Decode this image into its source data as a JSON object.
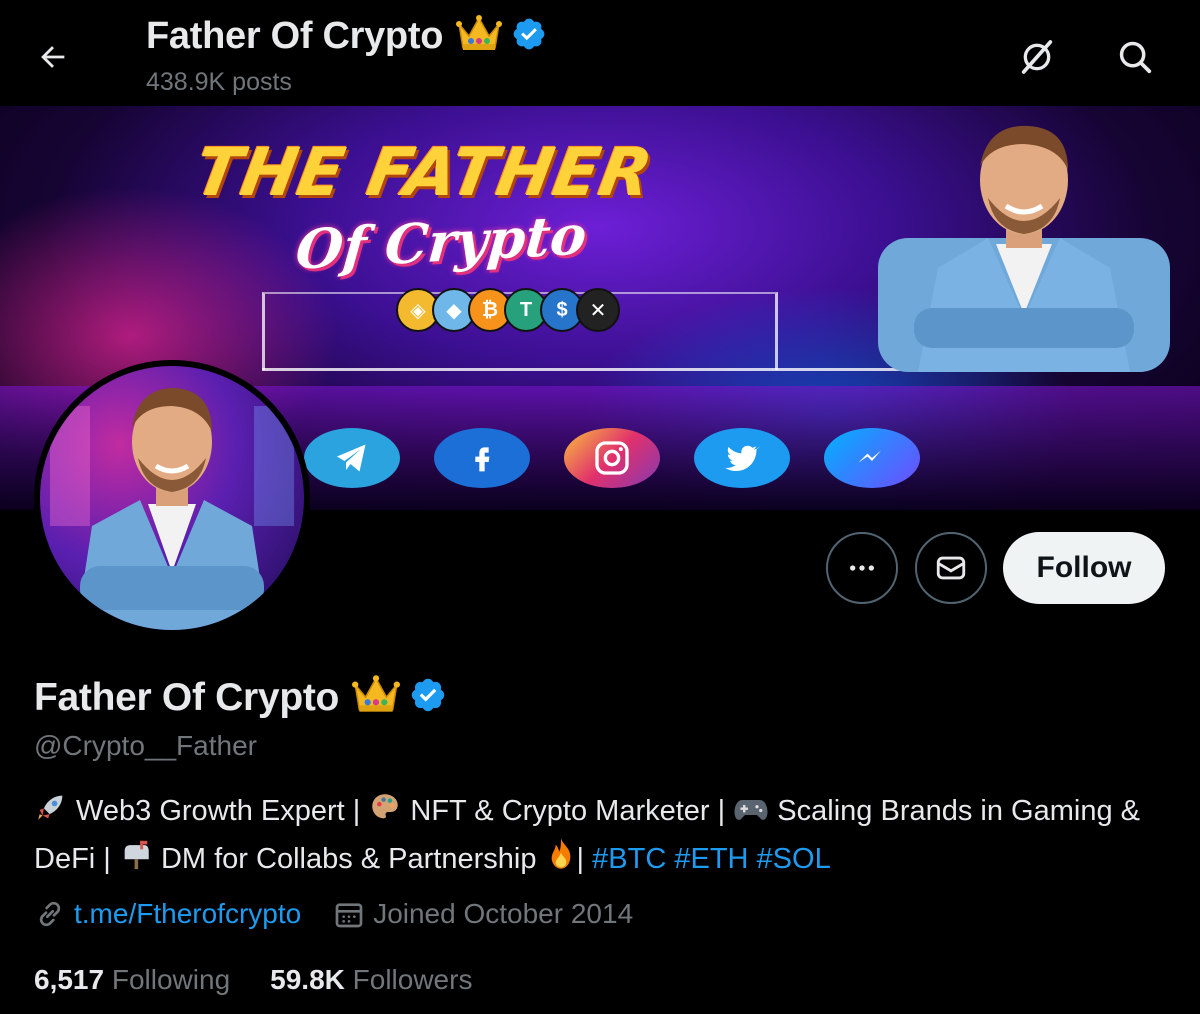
{
  "header": {
    "name": "Father Of Crypto",
    "posts_count": "438.9K posts",
    "back_icon": "arrow-left-icon",
    "grok_icon": "grok-icon",
    "search_icon": "search-icon"
  },
  "banner": {
    "title_line1": "THE FATHER",
    "title_line2": "Of Crypto",
    "coins": [
      "binance-coin",
      "ethereum",
      "bitcoin",
      "tether",
      "usd-coin",
      "xrp"
    ],
    "socials": [
      "telegram-icon",
      "facebook-icon",
      "instagram-icon",
      "twitter-icon",
      "messenger-icon"
    ]
  },
  "actions": {
    "more_icon": "more-icon",
    "message_icon": "message-icon",
    "follow_label": "Follow"
  },
  "profile": {
    "name": "Father Of Crypto",
    "handle": "@Crypto__Father",
    "bio_part1": " Web3 Growth Expert | ",
    "bio_part2": " NFT & Crypto Marketer | ",
    "bio_part3": " Scaling Brands in Gaming & DeFi | ",
    "bio_part4": " DM for Collabs & Partnership ",
    "bio_part5": "| ",
    "hashtags": [
      "#BTC",
      "#ETH",
      "#SOL"
    ],
    "link": "t.me/Ftherofcrypto",
    "joined": "Joined October 2014"
  },
  "stats": {
    "following_count": "6,517",
    "following_label": "Following",
    "followers_count": "59.8K",
    "followers_label": "Followers"
  },
  "colors": {
    "background": "#000000",
    "text": "#e7e9ea",
    "muted": "#71767b",
    "accent": "#1d9bf0",
    "verified": "#1d9bf0",
    "follow_bg": "#eff3f4"
  }
}
